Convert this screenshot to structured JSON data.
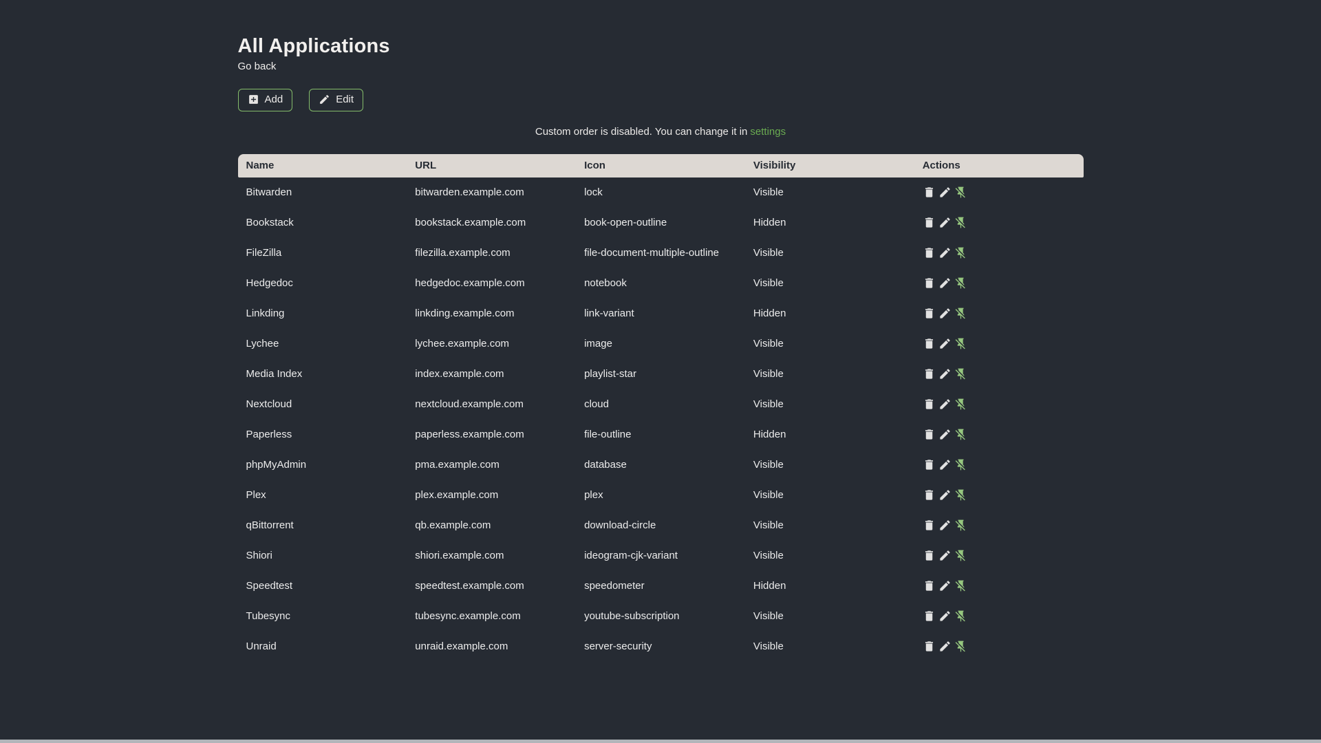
{
  "page": {
    "title": "All Applications",
    "back_link": "Go back",
    "notice_text": "Custom order is disabled. You can change it in",
    "notice_link": "settings"
  },
  "toolbar": {
    "add_label": "Add",
    "edit_label": "Edit"
  },
  "icons": {
    "add_button": "plus-box",
    "edit_button": "pencil",
    "row_actions": [
      "delete",
      "pencil",
      "pin-off"
    ]
  },
  "colors": {
    "background": "#262b33",
    "table_header_bg": "#ddd8d3",
    "body_text": "#ececec",
    "accent_green": "#6aab51",
    "button_border_green": "#84bc6a",
    "pin_green": "#96c77f",
    "scrollbar": "#b2b5ba"
  },
  "table": {
    "headers": [
      "Name",
      "URL",
      "Icon",
      "Visibility",
      "Actions"
    ],
    "rows": [
      {
        "name": "Bitwarden",
        "url": "bitwarden.example.com",
        "icon": "lock",
        "visibility": "Visible"
      },
      {
        "name": "Bookstack",
        "url": "bookstack.example.com",
        "icon": "book-open-outline",
        "visibility": "Hidden"
      },
      {
        "name": "FileZilla",
        "url": "filezilla.example.com",
        "icon": "file-document-multiple-outline",
        "visibility": "Visible"
      },
      {
        "name": "Hedgedoc",
        "url": "hedgedoc.example.com",
        "icon": "notebook",
        "visibility": "Visible"
      },
      {
        "name": "Linkding",
        "url": "linkding.example.com",
        "icon": "link-variant",
        "visibility": "Hidden"
      },
      {
        "name": "Lychee",
        "url": "lychee.example.com",
        "icon": "image",
        "visibility": "Visible"
      },
      {
        "name": "Media Index",
        "url": "index.example.com",
        "icon": "playlist-star",
        "visibility": "Visible"
      },
      {
        "name": "Nextcloud",
        "url": "nextcloud.example.com",
        "icon": "cloud",
        "visibility": "Visible"
      },
      {
        "name": "Paperless",
        "url": "paperless.example.com",
        "icon": "file-outline",
        "visibility": "Hidden"
      },
      {
        "name": "phpMyAdmin",
        "url": "pma.example.com",
        "icon": "database",
        "visibility": "Visible"
      },
      {
        "name": "Plex",
        "url": "plex.example.com",
        "icon": "plex",
        "visibility": "Visible"
      },
      {
        "name": "qBittorrent",
        "url": "qb.example.com",
        "icon": "download-circle",
        "visibility": "Visible"
      },
      {
        "name": "Shiori",
        "url": "shiori.example.com",
        "icon": "ideogram-cjk-variant",
        "visibility": "Visible"
      },
      {
        "name": "Speedtest",
        "url": "speedtest.example.com",
        "icon": "speedometer",
        "visibility": "Hidden"
      },
      {
        "name": "Tubesync",
        "url": "tubesync.example.com",
        "icon": "youtube-subscription",
        "visibility": "Visible"
      },
      {
        "name": "Unraid",
        "url": "unraid.example.com",
        "icon": "server-security",
        "visibility": "Visible"
      }
    ]
  }
}
